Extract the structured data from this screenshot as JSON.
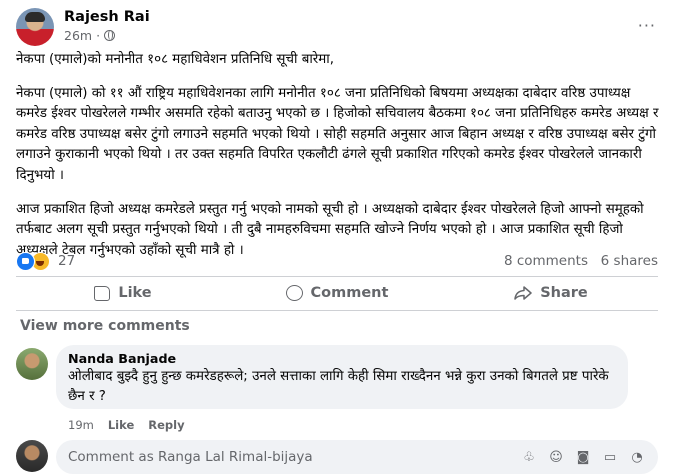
{
  "post": {
    "author": "Rajesh Rai",
    "time": "26m",
    "dot": "·",
    "more": "···",
    "paragraphs": [
      "नेकपा (एमाले)को मनोनीत १०८ महाधिवेशन प्रतिनिधि सूची बारेमा,",
      "नेकपा (एमाले) को ११ औं राष्ट्रिय महाधिवेशनका लागि मनोनीत १०८ जना प्रतिनिधिको बिषयमा अध्यक्षका दाबेदार वरिष्ठ उपाध्यक्ष कमरेड ईश्वर पोखरेलले गम्भीर असमति रहेको बताउनु भएको छ । हिजोको सचिवालय बैठकमा १०८ जना प्रतिनिधिहरु कमरेड अध्यक्ष र कमरेड वरिष्ठ उपाध्यक्ष बसेर टुंगो लगाउने सहमति भएको थियो । सोही सहमति अनुसार आज बिहान अध्यक्ष र वरिष्ठ उपाध्यक्ष बसेर टुंगो लगाउने कुराकानी भएको थियो । तर उक्त सहमति विपरित एकलौटी ढंगले सूची प्रकाशित गरिएको कमरेड ईश्वर पोखरेलले जानकारी दिनुभयो ।",
      "आज प्रकाशित हिजो अध्यक्ष कमरेडले प्रस्तुत गर्नु भएको नामको सूची हो । अध्यक्षको दाबेदार ईश्वर पोखरेलले हिजो आफ्नो समूहको तर्फबाट अलग सूची प्रस्तुत गर्नुभएको थियो । ती दुबै नामहरुविचमा सहमति खोज्ने निर्णय भएको हो । आज प्रकाशित सूची हिजो अध्यक्षले टेबल गर्नुभएको उहाँको सूची मात्रै हो ।"
    ]
  },
  "stats": {
    "reactions": "27",
    "comments": "8 comments",
    "shares": "6 shares"
  },
  "actions": {
    "like": "Like",
    "comment": "Comment",
    "share": "Share"
  },
  "view_more": "View more comments",
  "comment": {
    "author": "Nanda Banjade",
    "text": "ओलीबाद बुझ्दै हुनु हुन्छ कमरेडहरूले; उनले सत्ताका लागि केही सिमा राख्दैनन भन्ने कुरा उनको बिगतले प्रष्ट पारेके छैन र ?",
    "time": "19m",
    "like": "Like",
    "reply": "Reply"
  },
  "reply_box": {
    "placeholder": "Comment as Ranga Lal Rimal-bijaya"
  },
  "colors": {
    "accent": "#1877f2",
    "muted": "#65676b",
    "bubble": "#f0f2f5"
  }
}
